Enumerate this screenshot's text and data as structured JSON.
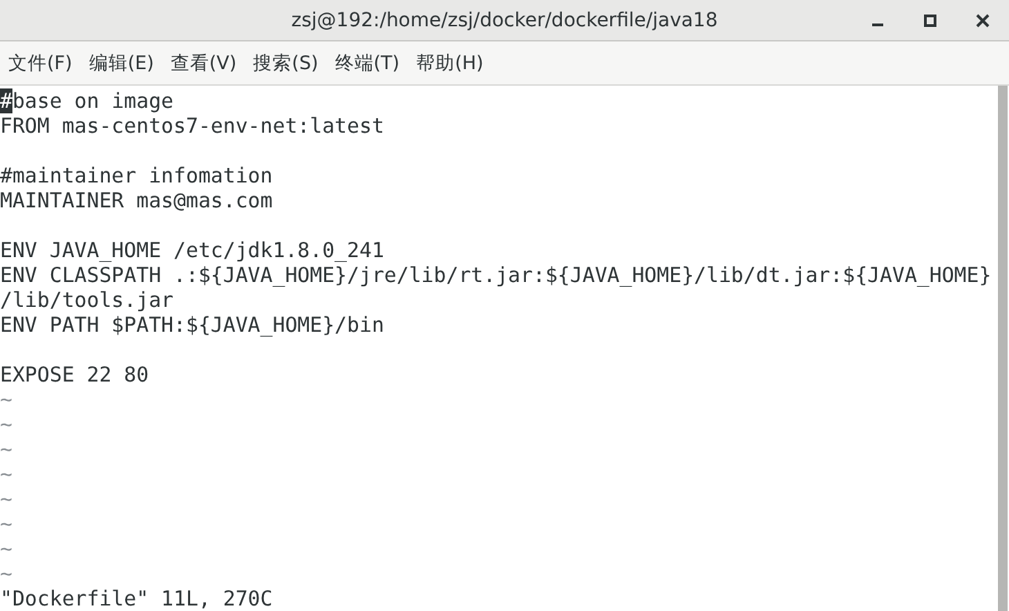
{
  "window": {
    "title": "zsj@192:/home/zsj/docker/dockerfile/java18"
  },
  "menu": [
    "文件(F)",
    "编辑(E)",
    "查看(V)",
    "搜索(S)",
    "终端(T)",
    "帮助(H)"
  ],
  "lines": [
    {
      "kind": "text",
      "text": "#base on image",
      "cursor": true
    },
    {
      "kind": "text",
      "text": "FROM mas-centos7-env-net:latest",
      "cursor": false
    },
    {
      "kind": "blank"
    },
    {
      "kind": "text",
      "text": "#maintainer infomation",
      "cursor": false
    },
    {
      "kind": "text",
      "text": "MAINTAINER mas@mas.com",
      "cursor": false
    },
    {
      "kind": "blank"
    },
    {
      "kind": "text",
      "text": "ENV JAVA_HOME /etc/jdk1.8.0_241",
      "cursor": false
    },
    {
      "kind": "text",
      "text": "ENV CLASSPATH .:${JAVA_HOME}/jre/lib/rt.jar:${JAVA_HOME}/lib/dt.jar:${JAVA_HOME}",
      "cursor": false
    },
    {
      "kind": "text",
      "text": "/lib/tools.jar",
      "cursor": false
    },
    {
      "kind": "text",
      "text": "ENV PATH $PATH:${JAVA_HOME}/bin",
      "cursor": false
    },
    {
      "kind": "blank"
    },
    {
      "kind": "text",
      "text": "EXPOSE 22 80",
      "cursor": false
    },
    {
      "kind": "filler",
      "text": "~"
    },
    {
      "kind": "filler",
      "text": "~"
    },
    {
      "kind": "filler",
      "text": "~"
    },
    {
      "kind": "filler",
      "text": "~"
    },
    {
      "kind": "filler",
      "text": "~"
    },
    {
      "kind": "filler",
      "text": "~"
    },
    {
      "kind": "filler",
      "text": "~"
    },
    {
      "kind": "filler",
      "text": "~"
    }
  ],
  "status_line": "\"Dockerfile\" 11L, 270C"
}
